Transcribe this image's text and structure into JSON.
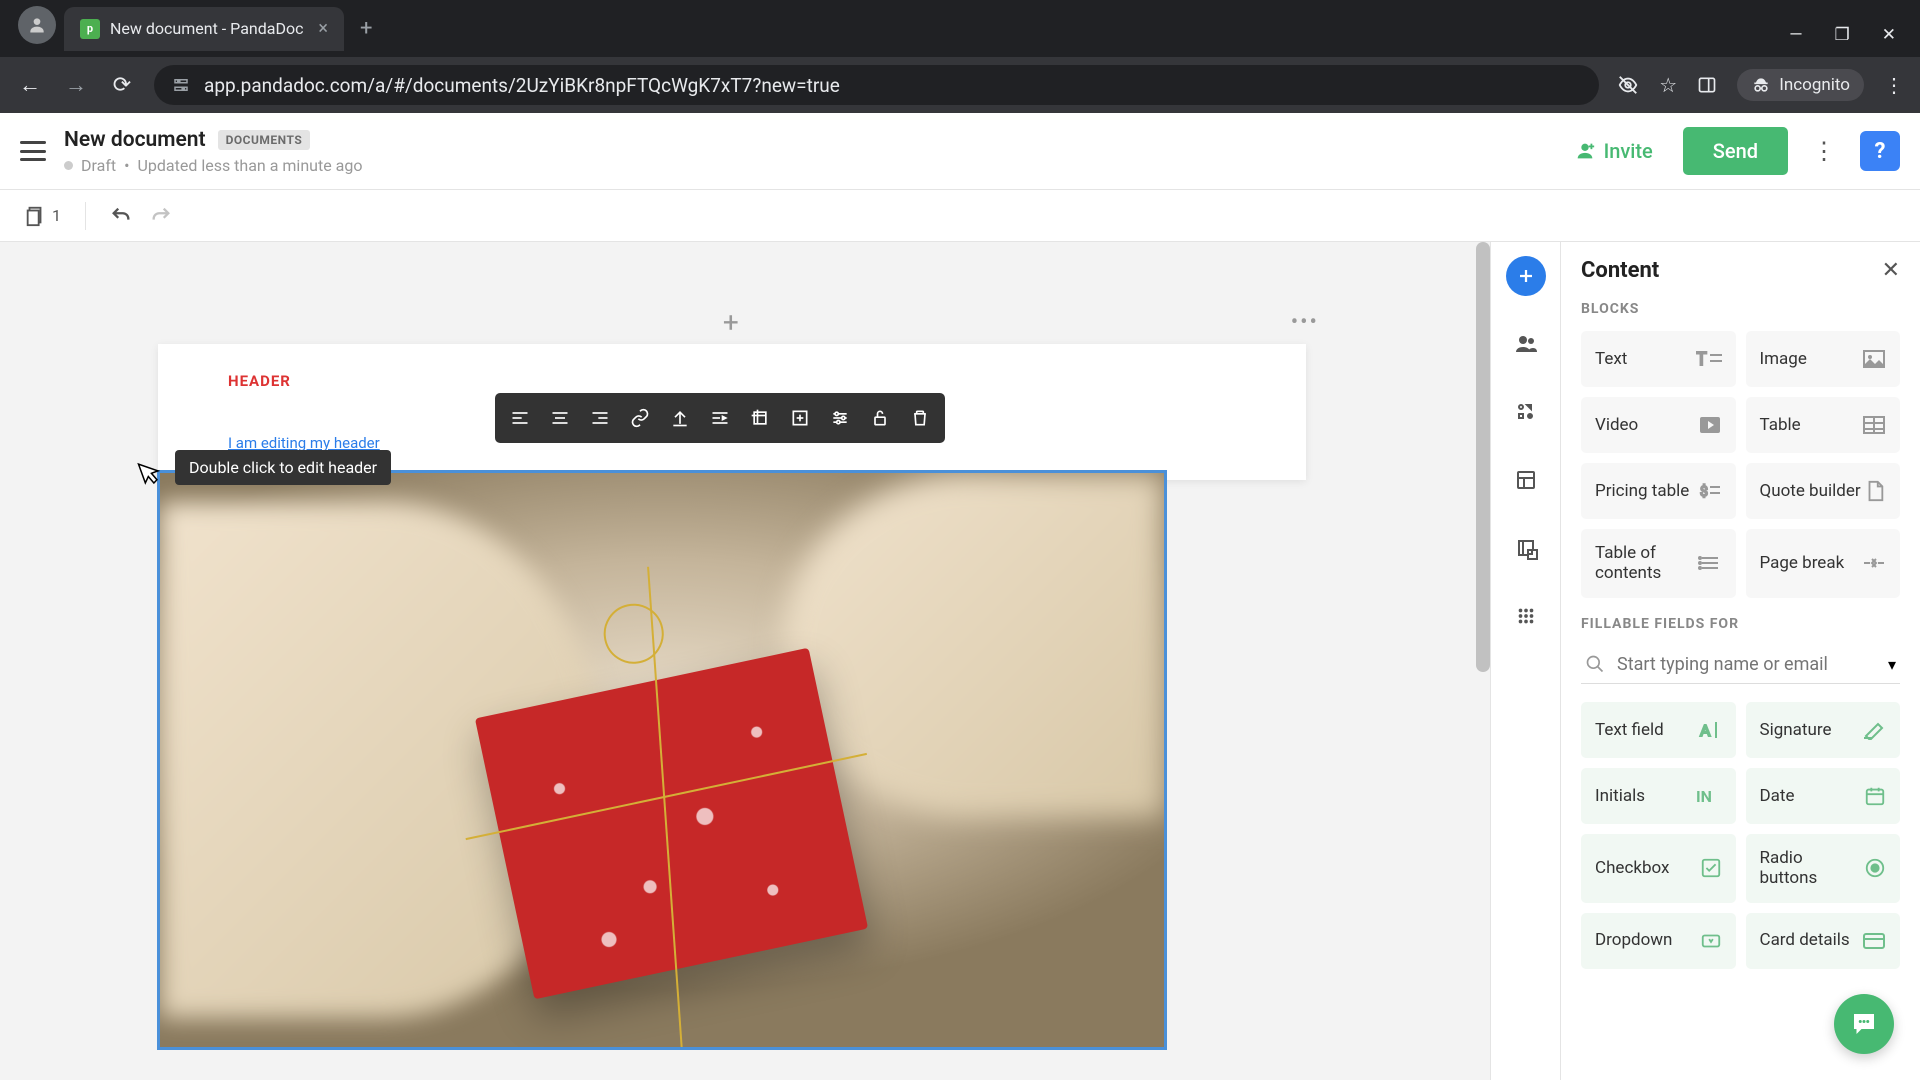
{
  "browser": {
    "tab_title": "New document - PandaDoc",
    "url": "app.pandadoc.com/a/#/documents/2UzYiBKr8npFTQcWgK7xT7?new=true",
    "incognito_label": "Incognito"
  },
  "header": {
    "title": "New document",
    "badge": "DOCUMENTS",
    "status_state": "Draft",
    "status_time": "Updated less than a minute ago",
    "invite_label": "Invite",
    "send_label": "Send"
  },
  "toolbar": {
    "page_count": "1"
  },
  "canvas": {
    "header_label": "HEADER",
    "header_text": "I am editing my header",
    "tooltip": "Double click to edit header"
  },
  "image_toolbar": {
    "items": [
      "align-left",
      "align-center",
      "align-right",
      "link",
      "replace",
      "wrap",
      "crop",
      "add",
      "settings",
      "lock",
      "delete"
    ]
  },
  "panel": {
    "title": "Content",
    "section_blocks": "BLOCKS",
    "section_fields": "FILLABLE FIELDS FOR",
    "search_placeholder": "Start typing name or email",
    "blocks": [
      {
        "label": "Text",
        "icon": "text-icon"
      },
      {
        "label": "Image",
        "icon": "image-icon"
      },
      {
        "label": "Video",
        "icon": "video-icon"
      },
      {
        "label": "Table",
        "icon": "table-icon"
      },
      {
        "label": "Pricing table",
        "icon": "pricing-icon"
      },
      {
        "label": "Quote builder",
        "icon": "quote-icon"
      },
      {
        "label": "Table of contents",
        "icon": "toc-icon"
      },
      {
        "label": "Page break",
        "icon": "break-icon"
      }
    ],
    "fields": [
      {
        "label": "Text field",
        "icon": "textfield-icon"
      },
      {
        "label": "Signature",
        "icon": "signature-icon"
      },
      {
        "label": "Initials",
        "icon": "initials-icon"
      },
      {
        "label": "Date",
        "icon": "date-icon"
      },
      {
        "label": "Checkbox",
        "icon": "checkbox-icon"
      },
      {
        "label": "Radio buttons",
        "icon": "radio-icon"
      },
      {
        "label": "Dropdown",
        "icon": "dropdown-icon"
      },
      {
        "label": "Card details",
        "icon": "card-icon"
      }
    ]
  }
}
